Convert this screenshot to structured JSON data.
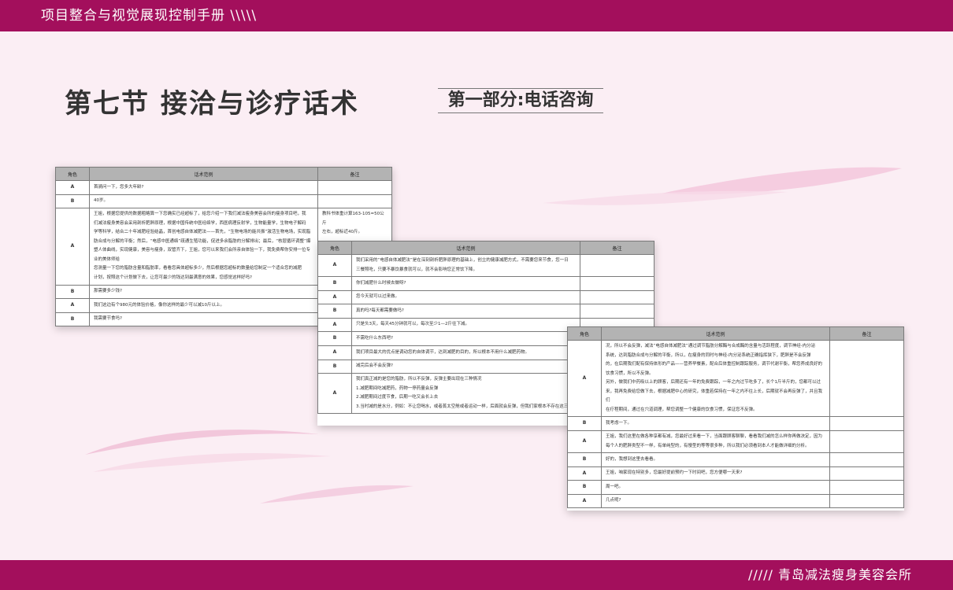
{
  "header": {
    "title": "项目整合与视觉展现控制手册 \\\\\\\\\\"
  },
  "footer": {
    "text": "///// 青岛减法瘦身美容会所"
  },
  "page": {
    "title": "第七节 接洽与诊疗话术",
    "subtitle": "第一部分:电话咨询"
  },
  "colors": {
    "brand": "#a30f5c",
    "background": "#fbeef4",
    "table_header": "#b3b3b3"
  },
  "tables": [
    {
      "headers": [
        "角色",
        "话术范例",
        "备注"
      ],
      "rows": [
        {
          "role": "A",
          "script": "首骑问一下，您多大年龄?",
          "note": ""
        },
        {
          "role": "B",
          "script": "40岁。",
          "note": ""
        },
        {
          "role": "A",
          "script": "王姐，根据您提供的数据粗略算一下您确实已经超标了，给您介绍一下我们减法瘦身美容会所的瘦身项目吧，我\n们减法瘦身美容会采用剖析肥胖原理，根据中国传统中医经络学，西医病理反射学，生物能量学，生物电子解码\n学等科学，结合二十年减肥经验结晶，首创电感自体减肥法——首先，“生物电场的能共振”激活生物电场，实现脂\n肪合成与分解的平衡；然后，“电感中医通络”疏通生殖功能，促进多余脂肪的分解排出；最后，“核层循环调整”爆\n塑人体曲线，实现健康，美容与瘦身，双管齐下，王姐，您可以来我们会所亲自体验一下，我免费帮你安排一位专业的美体师给\n您测量一下您的脂肪含量和脂肪率，看看您具体超标多少，然后根据您超标的数量给您制定一个适合您的减肥\n计划，按照这个计划做下去，让您可最少的钱达到最满意的效果，您感觉这样好吗?",
          "note": "教科书体重计算163-105=50公斤\n左右，超标近40斤。"
        },
        {
          "role": "B",
          "script": "那需要多少钱?",
          "note": ""
        },
        {
          "role": "A",
          "script": "我们这边有个980元的体验价格，像你这样的最少可以减10斤以上。",
          "note": ""
        },
        {
          "role": "B",
          "script": "我需要节食吗?",
          "note": ""
        }
      ]
    },
    {
      "headers": [
        "角色",
        "话术范例",
        "备注"
      ],
      "rows": [
        {
          "role": "A",
          "script": "我们采用的“电感自体减肥法”是在深刻剖析肥胖原理的基础上，创立的健康减肥方式，不需要您来节食，您一日\n三餐照吃，只要不暴饮暴食就可以，就不会影响您正常饮下降。",
          "note": ""
        },
        {
          "role": "B",
          "script": "你们减肥什么时候去做呀?",
          "note": ""
        },
        {
          "role": "A",
          "script": "您今天就可以过来做。",
          "note": ""
        },
        {
          "role": "B",
          "script": "真的吗?每天都需要做吗?",
          "note": ""
        },
        {
          "role": "A",
          "script": "只是头3天，每天45分钟就可以，每次至少1—2斤往下减。",
          "note": ""
        },
        {
          "role": "B",
          "script": "不需吃什么东西吧?",
          "note": ""
        },
        {
          "role": "A",
          "script": "我们项目最大的优点是调动您的自体调节，达到减肥的目的，所以根本不用什么减肥药物。",
          "note": ""
        },
        {
          "role": "B",
          "script": "减完后会不会反弹?",
          "note": ""
        },
        {
          "role": "A",
          "script": "我们真正减的是您的脂肪，所以不反弹，反弹主要出现在三种情况\n1.减肥期间吃减肥药，药物一停药量会反弹\n2.减肥期间过度节食，后期一吃又会长上去\n3.当时减的是水分，例如：不让您喝水，或者蒸太空舱或者运动一样，后面就会反弹，但我们家根本不存在这三",
          "note": ""
        }
      ]
    },
    {
      "headers": [
        "角色",
        "话术范例",
        "备注"
      ],
      "rows": [
        {
          "role": "A",
          "script": "况，所以不会反弹，减法“电感自体减肥法”通过调节脂肪分解酶与合成酶的含量与活跃程度，调节神经-内分泌\n系统，达到脂肪合成与分解的平衡，所以，在瘦身的同时与神经-内分泌系统正确指挥狭下，肥胖是不会反弹\n的，在后期我们配有保持体形的产品——营养早餐素，配合后体重控制跟踪服务，调节代谢平衡，帮您养成良好的\n饮食习惯，所以不反弹。\n另外，做我们中药吸以上的顾客，后期还有一年的免费跟踪，一年之内过节吃多了，长个1斤半斤的，您都可以过\n来，我再免费给您做下去，根据减肥中心的研究，体重若保持在一年之内不往上长，后期就不会再反弹了，并且我们\n在疗程期间，通过在穴道调理，帮您调整一个健康的饮食习惯，保证您不反弹。",
          "note": ""
        },
        {
          "role": "B",
          "script": "我考虑一下。",
          "note": ""
        },
        {
          "role": "A",
          "script": "王姐，我们这里在做各种享都有减，您最好过来看一下，当面跟顾客聊聊，看看我们减的怎么样你再做决定，因为\n每个人的肥胖类型不一样，有单纯型的，有慢型的等等很多种，所以我们必须看到本人才能做详细的分析。",
          "note": ""
        },
        {
          "role": "B",
          "script": "好的，我想到这里去看看。",
          "note": ""
        },
        {
          "role": "A",
          "script": "王姐，咱家现在特别多，您最好提前预约一下时间吧，您方便哪一天来?",
          "note": ""
        },
        {
          "role": "B",
          "script": "周一吧。",
          "note": ""
        },
        {
          "role": "A",
          "script": "几点呢?",
          "note": ""
        }
      ]
    }
  ]
}
